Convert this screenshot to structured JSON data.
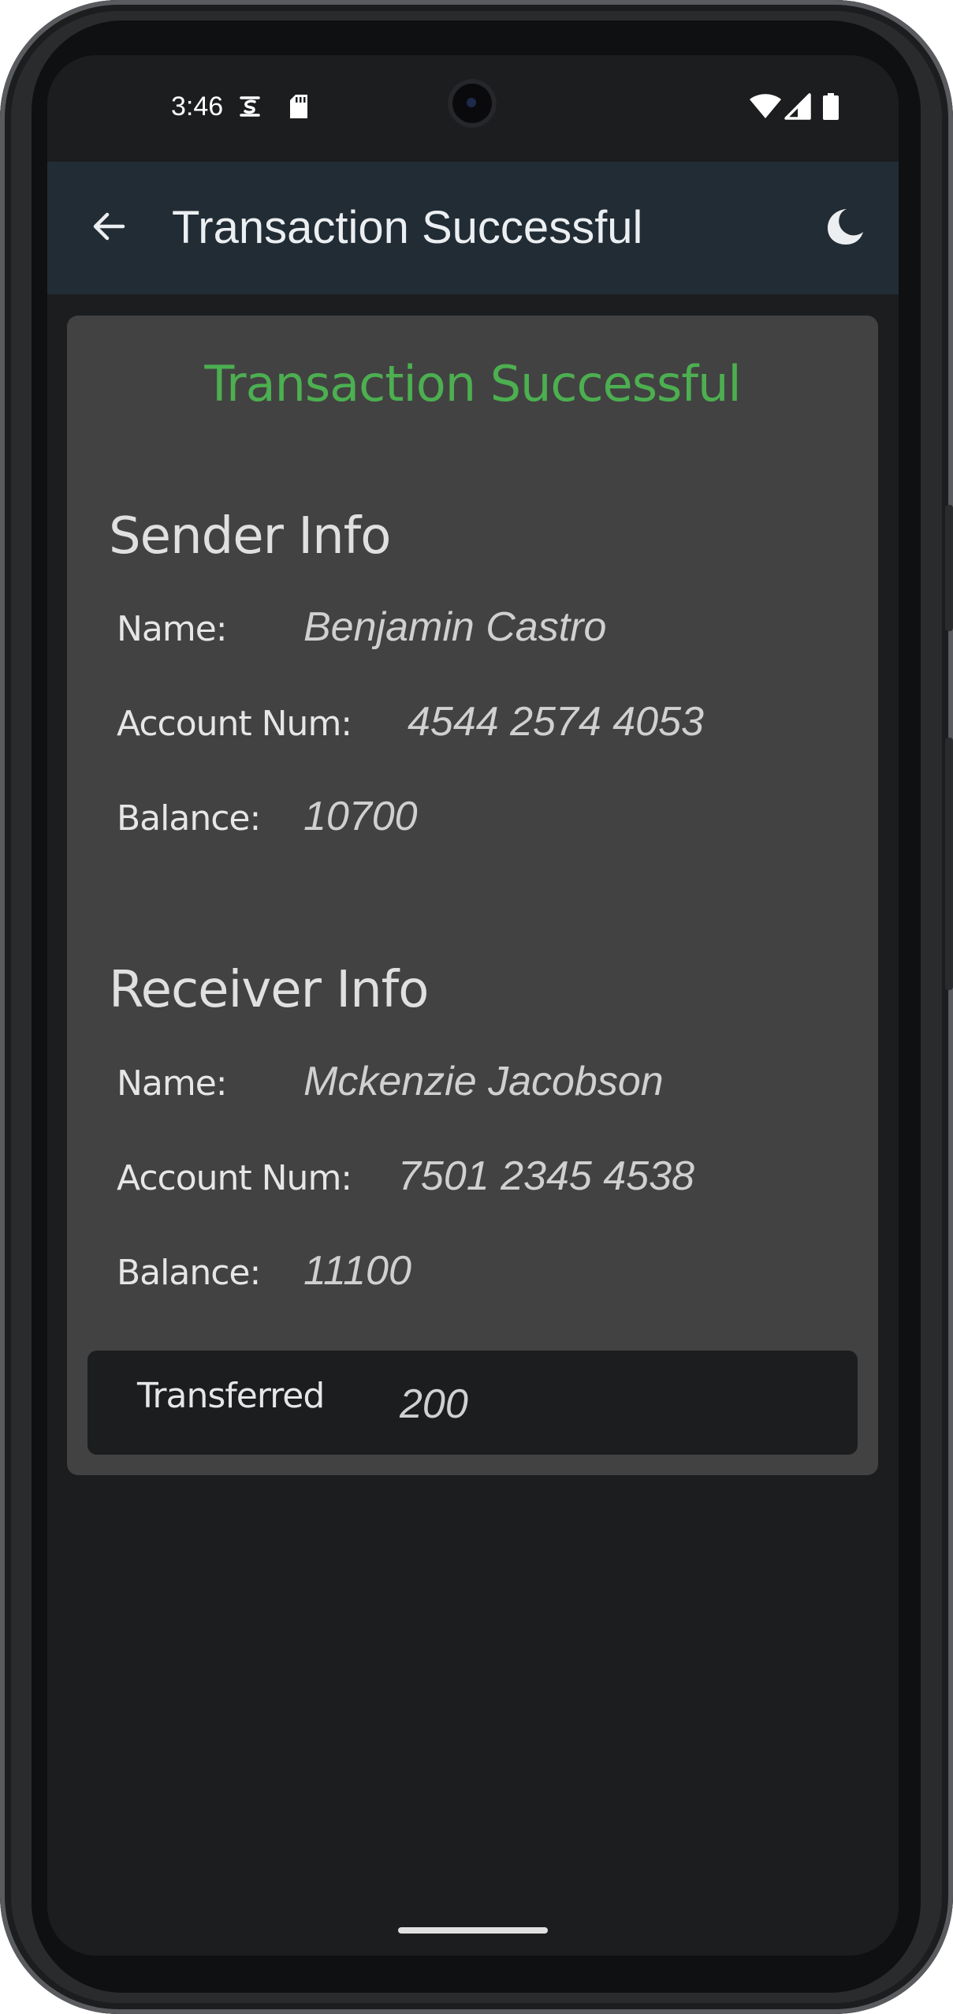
{
  "status_bar": {
    "time": "3:46",
    "left_icons": [
      "sim-toolkit-icon",
      "sd-card-icon"
    ],
    "right_icons": [
      "wifi-icon",
      "cellular-signal-icon",
      "battery-icon"
    ]
  },
  "app_bar": {
    "title": "Transaction Successful",
    "back_icon": "arrow-left-icon",
    "theme_icon": "moon-icon"
  },
  "card": {
    "heading": "Transaction Successful",
    "heading_color": "#4caf50",
    "sender": {
      "section_title": "Sender Info",
      "name_label": "Name:",
      "name_value": "Benjamin Castro",
      "account_label": "Account Num:",
      "account_value": "4544 2574 4053",
      "balance_label": "Balance:",
      "balance_value": "10700"
    },
    "receiver": {
      "section_title": "Receiver Info",
      "name_label": "Name:",
      "name_value": "Mckenzie Jacobson",
      "account_label": "Account Num:",
      "account_value": "7501 2345 4538",
      "balance_label": "Balance:",
      "balance_value": "11100"
    },
    "transfer": {
      "label": "Transferred",
      "value": "200"
    }
  },
  "colors": {
    "app_bar_bg": "#222c35",
    "card_bg": "#424242",
    "screen_bg": "#1b1d1f",
    "accent_success": "#4caf50"
  }
}
